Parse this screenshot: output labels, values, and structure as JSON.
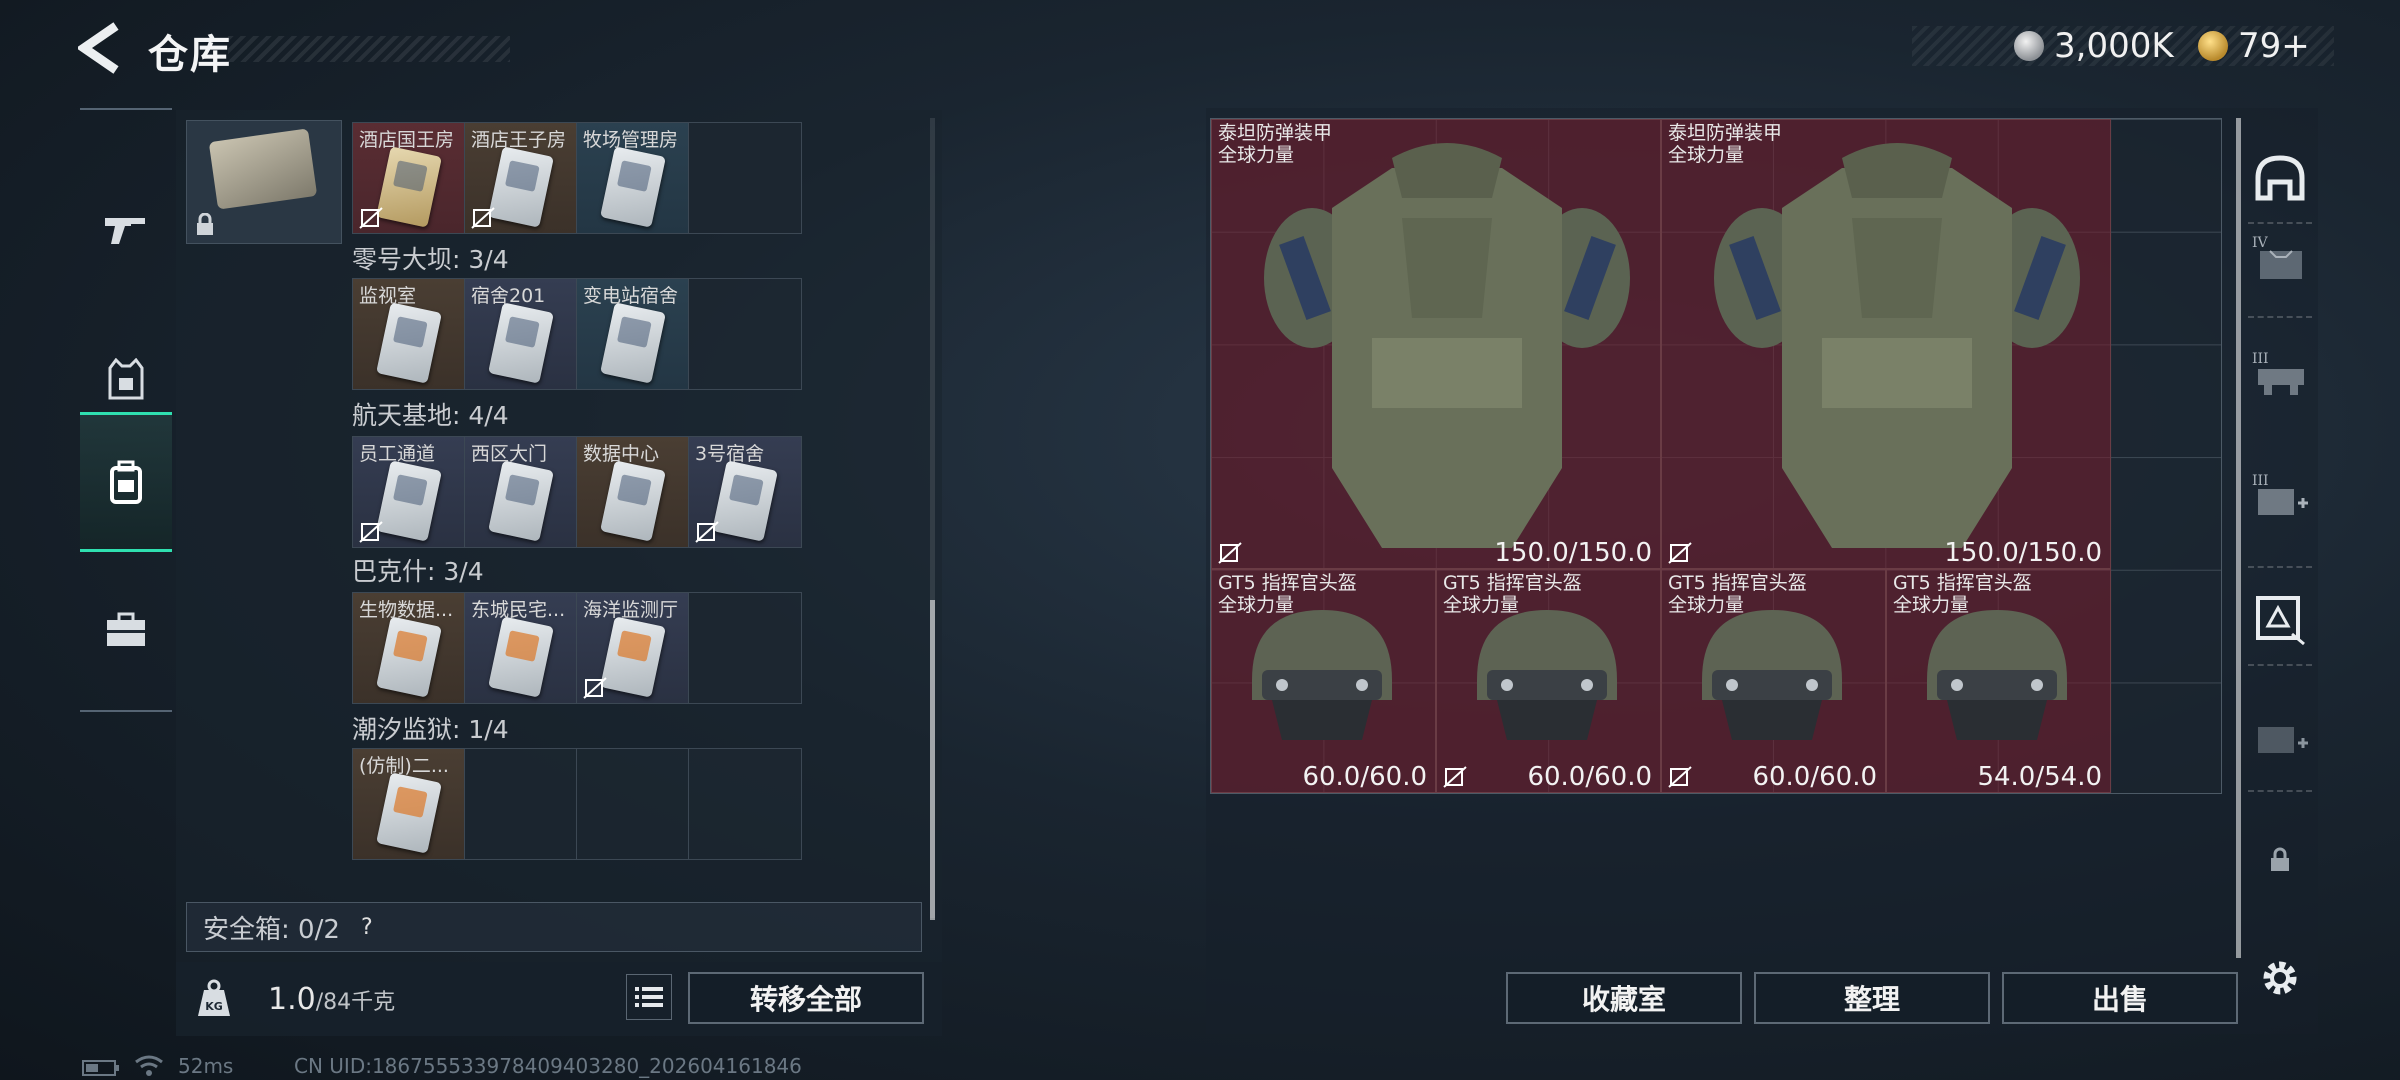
{
  "header": {
    "title": "仓库"
  },
  "currency": [
    {
      "name": "silver-coin-icon",
      "value": "3,000K",
      "color": "#c6c9cc"
    },
    {
      "name": "gold-triangle-coin-icon",
      "value": "79+",
      "color": "#d4a94a"
    }
  ],
  "nav": [
    {
      "name": "nav-weapons",
      "icon": "gun-icon"
    },
    {
      "name": "nav-armor",
      "icon": "vest-icon"
    },
    {
      "name": "nav-backpack",
      "icon": "backpack-icon",
      "active": true
    },
    {
      "name": "nav-case",
      "icon": "briefcase-icon"
    }
  ],
  "keycards": {
    "row0": [
      "酒店国王房",
      "酒店王子房",
      "牧场管理房"
    ],
    "groups": [
      {
        "label": "零号大坝: 3/4",
        "cards": [
          "监视室",
          "宿舍201",
          "变电站宿舍"
        ]
      },
      {
        "label": "航天基地: 4/4",
        "cards": [
          "员工通道",
          "西区大门",
          "数据中心",
          "3号宿舍"
        ]
      },
      {
        "label": "巴克什: 3/4",
        "cards": [
          "生物数据...",
          "东城民宅...",
          "海洋监测厅"
        ]
      },
      {
        "label": "潮汐监狱: 1/4",
        "cards": [
          "(仿制)二..."
        ]
      }
    ]
  },
  "safe_box": {
    "label": "安全箱: 0/2",
    "help": "?"
  },
  "weight": {
    "value": "1.0",
    "capacity": "/84千克"
  },
  "buttons": {
    "transfer_all": "转移全部",
    "collection": "收藏室",
    "sort": "整理",
    "sell": "出售"
  },
  "stash_items": [
    {
      "name": "泰坦防弹装甲",
      "sub": "全球力量",
      "durability": "150.0/150.0",
      "type": "armor"
    },
    {
      "name": "泰坦防弹装甲",
      "sub": "全球力量",
      "durability": "150.0/150.0",
      "type": "armor"
    },
    {
      "name": "GT5 指挥官头盔",
      "sub": "全球力量",
      "durability": "60.0/60.0",
      "type": "helmet"
    },
    {
      "name": "GT5 指挥官头盔",
      "sub": "全球力量",
      "durability": "60.0/60.0",
      "type": "helmet"
    },
    {
      "name": "GT5 指挥官头盔",
      "sub": "全球力量",
      "durability": "60.0/60.0",
      "type": "helmet"
    },
    {
      "name": "GT5 指挥官头盔",
      "sub": "全球力量",
      "durability": "54.0/54.0",
      "type": "helmet"
    }
  ],
  "side_tools": [
    "helmet-slot-icon",
    "armor-iv-icon",
    "rig-iii-icon",
    "backpack-add-icon",
    "safe-box-icon",
    "backpack-add-2-icon",
    "lock-icon",
    "settings-icon"
  ],
  "status": {
    "ping": "52ms",
    "uid": "CN UID:18675553397840940328​0_202604161846"
  }
}
